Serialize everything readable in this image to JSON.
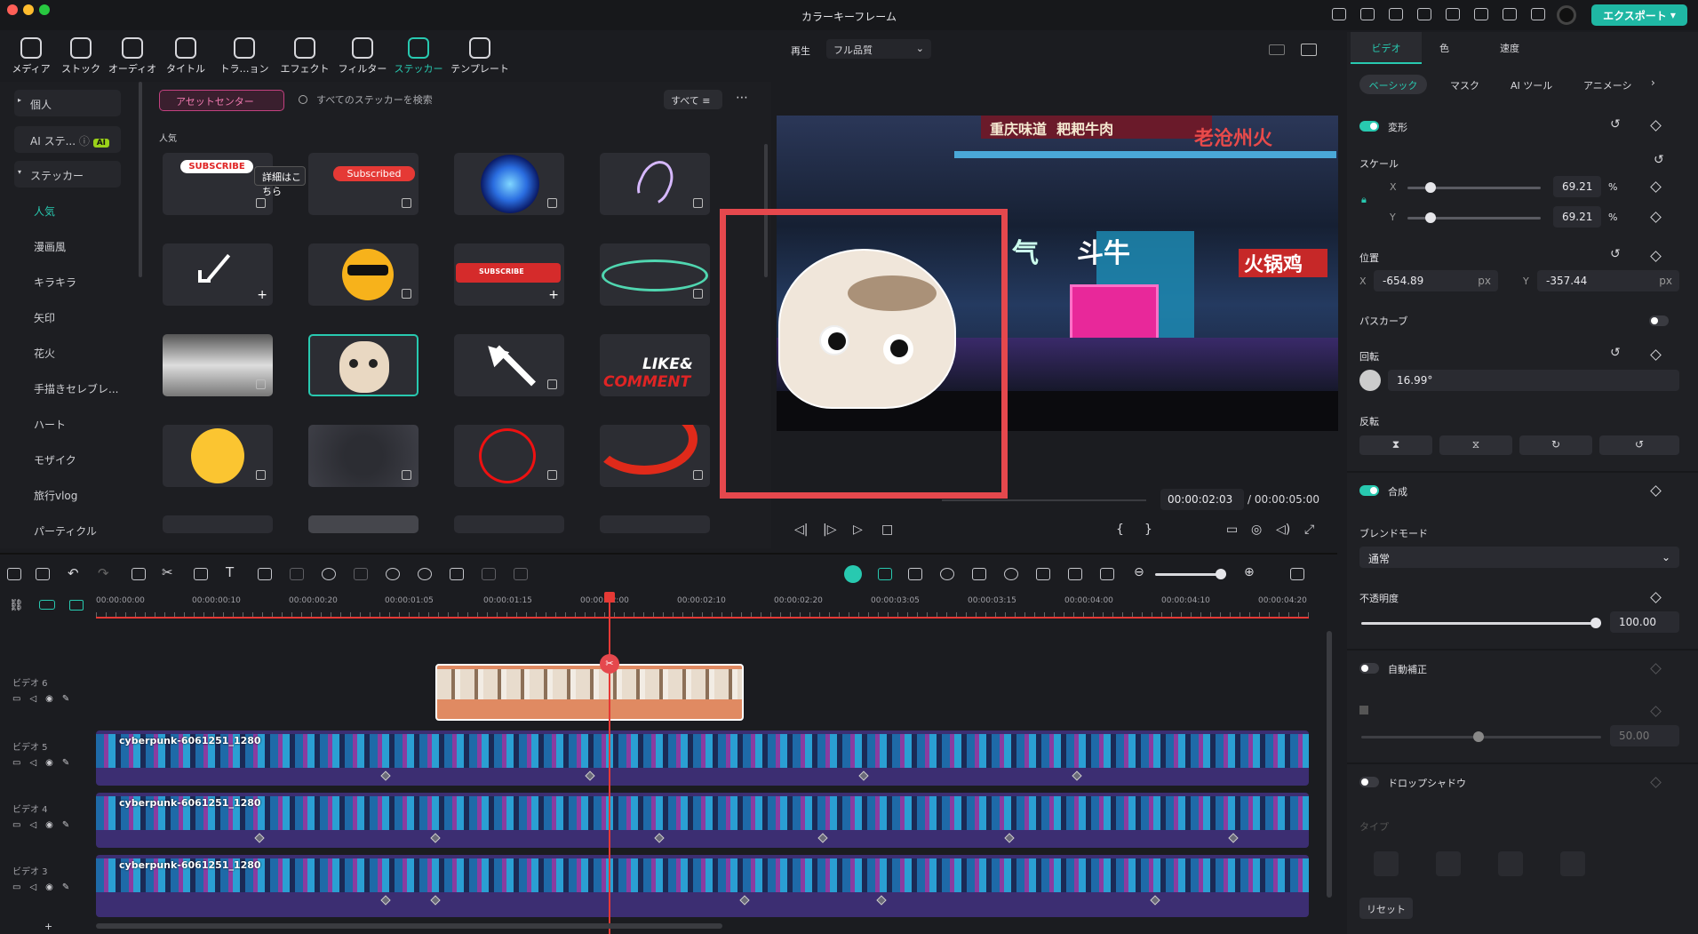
{
  "app": {
    "title": "カラーキーフレーム",
    "export_label": "エクスポート"
  },
  "media_tabs": [
    {
      "label": "メディア"
    },
    {
      "label": "ストック"
    },
    {
      "label": "オーディオ"
    },
    {
      "label": "タイトル"
    },
    {
      "label": "トラ…ョン"
    },
    {
      "label": "エフェクト"
    },
    {
      "label": "フィルター"
    },
    {
      "label": "ステッカー"
    },
    {
      "label": "テンプレート"
    }
  ],
  "sidebar": {
    "personal": "個人",
    "ai_sticker": "AI ステ...",
    "ai_badge": "AI",
    "sticker_group": "ステッカー",
    "items": [
      "人気",
      "漫画風",
      "キラキラ",
      "矢印",
      "花火",
      "手描きセレブレ...",
      "ハート",
      "モザイク",
      "旅行vlog",
      "パーティクル"
    ]
  },
  "sticker_panel": {
    "asset_center": "アセットセンター",
    "search_placeholder": "すべてのステッカーを検索",
    "filter_label": "すべて",
    "section_title": "人気",
    "tooltip": "詳細はこちら",
    "sticker_texts": {
      "subscribe": "SUBSCRIBE",
      "subscribed": "Subscribed",
      "subscribe2": "SUBSCRIBE",
      "like": "LIKE&",
      "comment": "COMMENT"
    }
  },
  "preview": {
    "play_label": "再生",
    "quality": "フル品質",
    "current_time": "00:00:02:03",
    "total_time": "/ 00:00:05:00",
    "signs": [
      "重庆味道",
      "耙耙牛肉",
      "老沧州火",
      "斗牛",
      "火锅鸡",
      "气"
    ]
  },
  "properties": {
    "tabs": [
      "ビデオ",
      "色",
      "速度"
    ],
    "subtabs": [
      "ベーシック",
      "マスク",
      "AI ツール",
      "アニメーシ"
    ],
    "transform": "変形",
    "scale": "スケール",
    "scale_x_label": "X",
    "scale_y_label": "Y",
    "scale_x": "69.21",
    "scale_y": "69.21",
    "percent": "%",
    "position": "位置",
    "pos_x_label": "X",
    "pos_x": "-654.89",
    "pos_y_label": "Y",
    "pos_y": "-357.44",
    "px": "px",
    "path_curve": "パスカーブ",
    "rotation": "回転",
    "rotation_value": "16.99°",
    "flip": "反転",
    "composite": "合成",
    "blend_mode": "ブレンドモード",
    "blend_value": "通常",
    "opacity": "不透明度",
    "opacity_value": "100.00",
    "auto_enhance": "自動補正",
    "auto_value": "50.00",
    "drop_shadow": "ドロップシャドウ",
    "type": "タイプ",
    "reset": "リセット"
  },
  "timeline": {
    "ruler": [
      "00:00:00:00",
      "00:00:00:10",
      "00:00:00:20",
      "00:00:01:05",
      "00:00:01:15",
      "00:00:02:00",
      "00:00:02:10",
      "00:00:02:20",
      "00:00:03:05",
      "00:00:03:15",
      "00:00:04:00",
      "00:00:04:10",
      "00:00:04:20"
    ],
    "tracks": [
      "ビデオ 6",
      "ビデオ 5",
      "ビデオ 4",
      "ビデオ 3"
    ],
    "clip_name": "cyberpunk-6061251_1280"
  }
}
